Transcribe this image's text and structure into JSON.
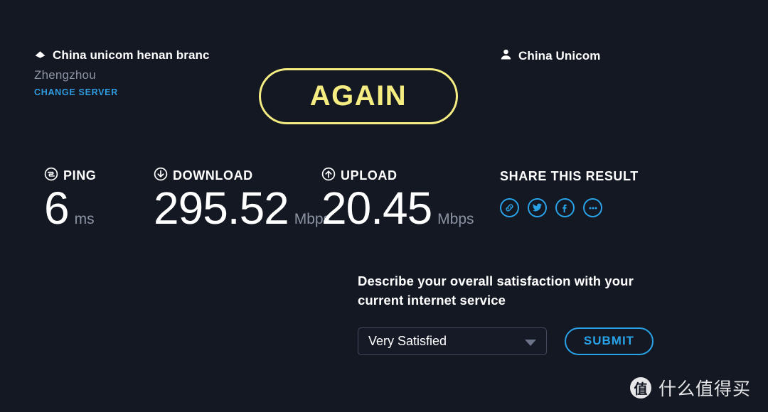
{
  "background_color": "#141823",
  "accent": {
    "yellow": "#f5ed81",
    "blue": "#29a3e8",
    "link_blue": "#2f9be0",
    "muted": "#8c93a3",
    "white": "#ffffff"
  },
  "server": {
    "icon": "server-diamond-icon",
    "name": "China unicom henan branc",
    "name_full": "China unicom henan branch",
    "city": "Zhengzhou",
    "change_server_label": "CHANGE SERVER"
  },
  "isp": {
    "icon": "person-icon",
    "name": "China Unicom"
  },
  "again_button": {
    "label": "AGAIN"
  },
  "results": [
    {
      "id": "ping",
      "icon": "ping-icon",
      "label": "PING",
      "value": "6",
      "unit": "ms"
    },
    {
      "id": "download",
      "icon": "download-arrow-icon",
      "label": "DOWNLOAD",
      "value": "295.52",
      "unit": "Mbps"
    },
    {
      "id": "upload",
      "icon": "upload-arrow-icon",
      "label": "UPLOAD",
      "value": "20.45",
      "unit": "Mbps"
    }
  ],
  "share": {
    "title": "SHARE THIS RESULT",
    "icons": [
      "link-icon",
      "twitter-icon",
      "facebook-icon",
      "more-ellipsis-icon"
    ]
  },
  "survey": {
    "question": "Describe your overall satisfaction with your current internet service",
    "selected_option": "Very Satisfied",
    "submit_label": "SUBMIT"
  },
  "watermark": {
    "logo_glyph": "值",
    "text": "什么值得买"
  }
}
